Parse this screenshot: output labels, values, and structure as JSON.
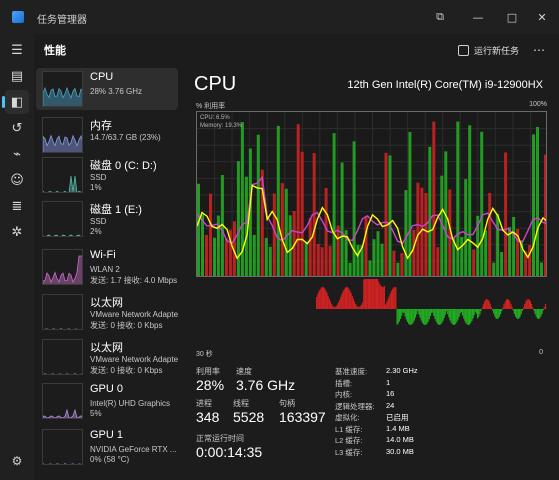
{
  "app": {
    "title": "任务管理器"
  },
  "window": {
    "minimize": "—",
    "maximize": "□",
    "close": "✕",
    "mode": "⧉"
  },
  "nav": [
    {
      "icon": "hamburger-icon",
      "glyph": "☰"
    },
    {
      "icon": "processes-icon",
      "glyph": "▤"
    },
    {
      "icon": "performance-icon",
      "glyph": "◧"
    },
    {
      "icon": "history-icon",
      "glyph": "↺"
    },
    {
      "icon": "startup-icon",
      "glyph": "⌁"
    },
    {
      "icon": "users-icon",
      "glyph": "☺"
    },
    {
      "icon": "details-icon",
      "glyph": "≣"
    },
    {
      "icon": "services-icon",
      "glyph": "✲"
    }
  ],
  "settings_glyph": "⚙",
  "header": {
    "title": "性能",
    "run_task": "运行新任务",
    "more": "⋯"
  },
  "sidebar": [
    {
      "name": "CPU",
      "sub1": "28%  3.76 GHz",
      "sub2": "",
      "color": "#4ba3c7",
      "load": 0.28
    },
    {
      "name": "内存",
      "sub1": "14.7/63.7 GB (23%)",
      "sub2": "",
      "color": "#8a9be8",
      "load": 0.23
    },
    {
      "name": "磁盘 0 (C: D:)",
      "sub1": "SSD",
      "sub2": "1%",
      "color": "#5ab8a8",
      "load": 0.01
    },
    {
      "name": "磁盘 1 (E:)",
      "sub1": "SSD",
      "sub2": "2%",
      "color": "#5ab8a8",
      "load": 0.02
    },
    {
      "name": "Wi-Fi",
      "sub1": "WLAN 2",
      "sub2": "发送: 1.7  接收: 4.0 Mbps",
      "color": "#c86ec8",
      "load": 0.1
    },
    {
      "name": "以太网",
      "sub1": "VMware Network Adapter",
      "sub2": "发送: 0  接收: 0 Kbps",
      "color": "#c86ec8",
      "load": 0
    },
    {
      "name": "以太网",
      "sub1": "VMware Network Adapter",
      "sub2": "发送: 0  接收: 0 Kbps",
      "color": "#c86ec8",
      "load": 0
    },
    {
      "name": "GPU 0",
      "sub1": "Intel(R) UHD Graphics",
      "sub2": "5%",
      "color": "#b48ce0",
      "load": 0.05
    },
    {
      "name": "GPU 1",
      "sub1": "NVIDIA GeForce RTX ...",
      "sub2": "0%  (58 °C)",
      "color": "#b48ce0",
      "load": 0
    }
  ],
  "main": {
    "title": "CPU",
    "model": "12th Gen Intel(R) Core(TM) i9-12900HX",
    "util_label": "% 利用率",
    "max_label": "100%",
    "time_left": "30 秒",
    "time_right": "0",
    "legend_cpu": "CPU: 6.5%",
    "legend_mem": "Memory: 19.3%",
    "colors": {
      "cpu_line": "#ffff00",
      "mem_line": "#cc44cc",
      "bar_green": "#22aa22",
      "bar_red": "#cc2222"
    }
  },
  "stats": {
    "util_label": "利用率",
    "util_value": "28%",
    "speed_label": "速度",
    "speed_value": "3.76 GHz",
    "proc_label": "进程",
    "proc_value": "348",
    "thread_label": "线程",
    "thread_value": "5528",
    "handle_label": "句柄",
    "handle_value": "163397",
    "uptime_label": "正常运行时间",
    "uptime_value": "0:00:14:35"
  },
  "specs": [
    {
      "k": "基准速度:",
      "v": "2.30 GHz"
    },
    {
      "k": "插槽:",
      "v": "1"
    },
    {
      "k": "内核:",
      "v": "16"
    },
    {
      "k": "逻辑处理器:",
      "v": "24"
    },
    {
      "k": "虚拟化:",
      "v": "已启用"
    },
    {
      "k": "L1 缓存:",
      "v": "1.4 MB"
    },
    {
      "k": "L2 缓存:",
      "v": "14.0 MB"
    },
    {
      "k": "L3 缓存:",
      "v": "30.0 MB"
    }
  ]
}
